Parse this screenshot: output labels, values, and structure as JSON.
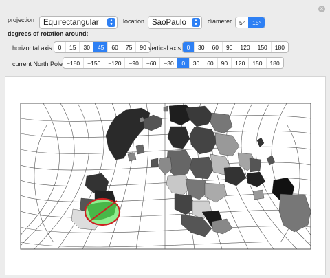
{
  "controls": {
    "projection_label": "projection",
    "projection_value": "Equirectangular",
    "location_label": "location",
    "location_value": "SaoPaulo",
    "diameter_label": "diameter",
    "diameter_options": [
      "5°",
      "15°"
    ],
    "diameter_selected": 1,
    "rotation_heading": "degrees of rotation around:",
    "horizontal_label": "horizontal axis",
    "horizontal_options": [
      "0",
      "15",
      "30",
      "45",
      "60",
      "75",
      "90"
    ],
    "horizontal_selected": 3,
    "vertical_label": "vertical axis",
    "vertical_options": [
      "0",
      "30",
      "60",
      "90",
      "120",
      "150",
      "180"
    ],
    "vertical_selected": 0,
    "north_pole_label": "current North Pole",
    "north_pole_options": [
      "−180",
      "−150",
      "−120",
      "−90",
      "−60",
      "−30",
      "0",
      "30",
      "60",
      "90",
      "120",
      "150",
      "180"
    ],
    "north_pole_selected": 6
  },
  "colors": {
    "accent": "#2e80f4",
    "circle_fill": "#90ee90",
    "circle_stroke": "#cc2222"
  },
  "icons": {
    "close": "close-icon",
    "popup_arrows": "chevron-updown-icon"
  }
}
